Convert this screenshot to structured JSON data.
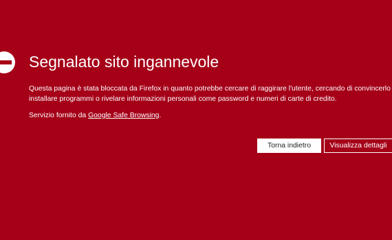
{
  "warning": {
    "title": "Segnalato sito ingannevole",
    "description_line1": "Questa pagina è stata bloccata da Firefox in quanto potrebbe cercare di raggirare l'utente, cercando di convincerlo a",
    "description_line2": "installare programmi o rivelare informazioni personali come password e numeri di carte di credito.",
    "provider_prefix": "Servizio fornito da ",
    "provider_link": "Google Safe Browsing",
    "provider_suffix": "."
  },
  "buttons": {
    "back_label": "Torna indietro",
    "details_label": "Visualizza dettagli"
  },
  "colors": {
    "background": "#a50018",
    "text": "#ffffff"
  },
  "icons": {
    "block": "blocked-icon"
  }
}
